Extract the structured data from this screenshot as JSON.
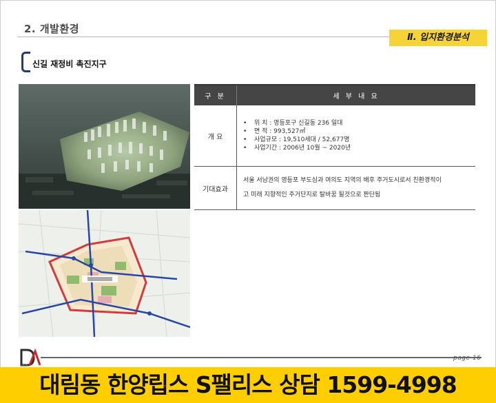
{
  "header": {
    "section_title": "2. 개발환경",
    "chapter_badge": "Ⅱ. 입지환경분석"
  },
  "subsection": {
    "title": "신길 재정비 촉진지구"
  },
  "table": {
    "headers": [
      "구 분",
      "세 부 내 요"
    ],
    "overview": {
      "label": "개 요",
      "items": [
        "위 치 : 영등포구 신길동 236 일대",
        "면 적 : 993,527㎡",
        "사업규모 : 19,510세대 / 52,677명",
        "사업기간 : 2006년 10월 ~ 2020년"
      ]
    },
    "effect": {
      "label": "기대효과",
      "lines": [
        "서울 서남권의 영등포 부도심과 여의도 지역의 배후 주거도시로서 친환경적이",
        "고 미래 지향적인 주거단지로 탈바꿈 될것으로 판단됨"
      ]
    }
  },
  "footer": {
    "logo_text": "DAELIM",
    "page": "page 16"
  },
  "banner": {
    "text": "대림동 한양립스 S팰리스 상담 1599-4998"
  },
  "colors": {
    "badge": "#f6d437",
    "banner": "#ffce00",
    "table_header": "#454545",
    "bracket": "#1d3e74"
  }
}
